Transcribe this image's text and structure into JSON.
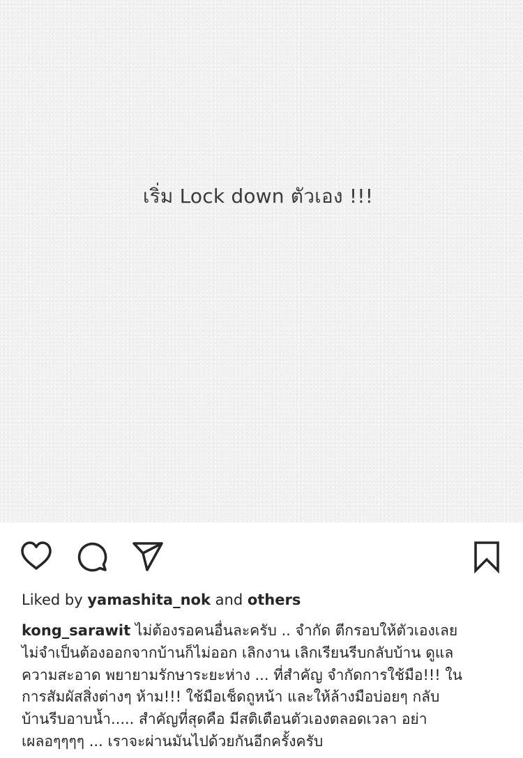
{
  "post": {
    "image_text": "เริ่ม Lock down ตัวเอง !!!"
  },
  "actions": {
    "like_icon": "heart-icon",
    "comment_icon": "comment-bubble-icon",
    "share_icon": "paper-plane-icon",
    "save_icon": "bookmark-icon"
  },
  "likes": {
    "prefix": "Liked by",
    "user": "yamashita_nok",
    "conjunction": "and",
    "others": "others"
  },
  "caption": {
    "username": "kong_sarawit",
    "line1": "ไม่ต้องรอคนอื่นละครับ .. จำกัด ตีกรอบให้ตัวเองเลย",
    "line2": "ไม่จำเป็นต้องออกจากบ้านก็ไม่ออก เลิกงาน เลิกเรียนรีบกลับบ้าน ดูแล",
    "line3": "ความสะอาด พยายามรักษาระยะห่าง ... ที่สำคัญ จำกัดการใช้มือ!!! ใน",
    "line4": "การสัมผัสสิ่งต่างๆ ห้าม!!! ใช้มือเช็ดถูหน้า และให้ล้างมือบ่อยๆ กลับ",
    "line5": "บ้านรีบอาบน้ำ..... สำคัญที่สุดคือ มีสติเตือนตัวเองตลอดเวลา อย่า",
    "line6": "เผลอๆๆๆๆ ... เราจะผ่านมันไปด้วยกันอีกครั้งครับ"
  },
  "colors": {
    "text": "#262626",
    "image_bg": "#f2f2f2"
  }
}
